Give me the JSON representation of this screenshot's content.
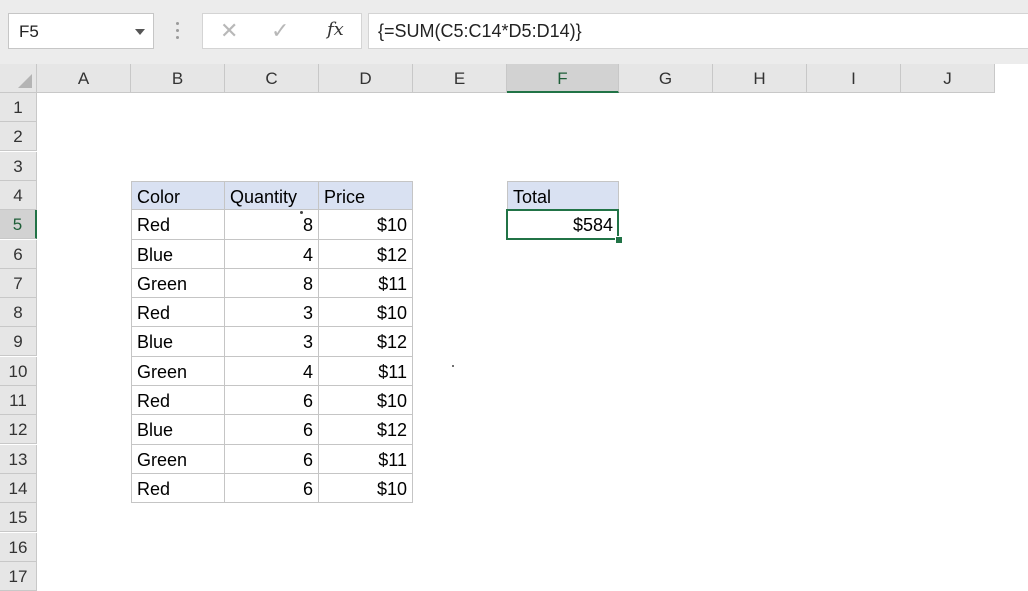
{
  "name_box": {
    "value": "F5"
  },
  "formula_bar": {
    "cancel_icon": "close-icon",
    "enter_icon": "check-icon",
    "fx_label": "fx",
    "formula": "{=SUM(C5:C14*D5:D14)}"
  },
  "columns": [
    "A",
    "B",
    "C",
    "D",
    "E",
    "F",
    "G",
    "H",
    "I",
    "J"
  ],
  "rows": [
    "1",
    "2",
    "3",
    "4",
    "5",
    "6",
    "7",
    "8",
    "9",
    "10",
    "11",
    "12",
    "13",
    "14",
    "15",
    "16",
    "17"
  ],
  "active_cell": {
    "column": "F",
    "row": "5"
  },
  "table": {
    "headers": [
      "Color",
      "Quantity",
      "Price"
    ],
    "rows": [
      [
        "Red",
        "8",
        "$10"
      ],
      [
        "Blue",
        "4",
        "$12"
      ],
      [
        "Green",
        "8",
        "$11"
      ],
      [
        "Red",
        "3",
        "$10"
      ],
      [
        "Blue",
        "3",
        "$12"
      ],
      [
        "Green",
        "4",
        "$11"
      ],
      [
        "Red",
        "6",
        "$10"
      ],
      [
        "Blue",
        "6",
        "$12"
      ],
      [
        "Green",
        "6",
        "$11"
      ],
      [
        "Red",
        "6",
        "$10"
      ]
    ]
  },
  "total": {
    "label": "Total",
    "value": "$584"
  },
  "colors": {
    "header_fill": "#d9e1f2",
    "selection_green": "#217346",
    "grid_line": "#c5c5c5"
  }
}
